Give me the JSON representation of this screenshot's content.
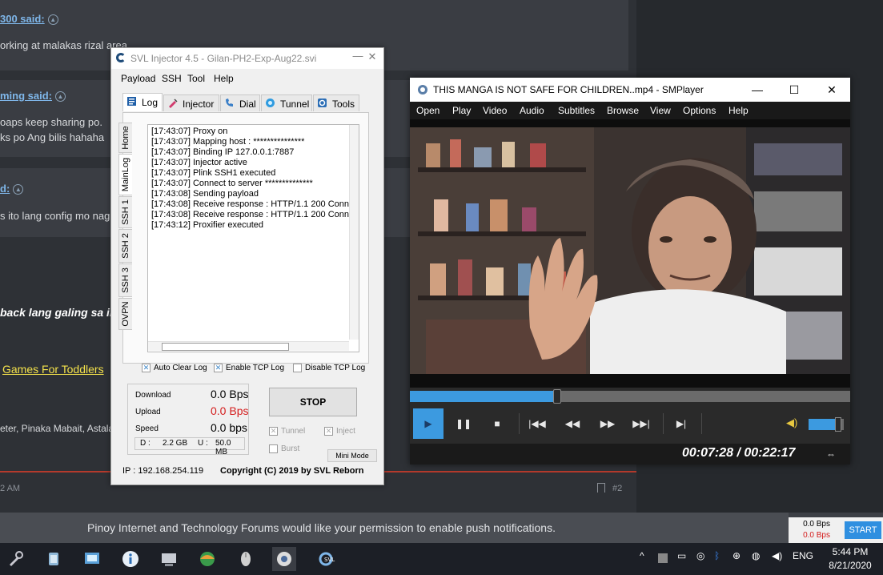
{
  "forum": {
    "post1_user": "300 said:",
    "post1_text": "orking at malakas rizal area",
    "post2_user": "ming said:",
    "post2_line1": "oaps keep sharing po.",
    "post2_line2": "ks po Ang bilis hahaha",
    "post3_user": "d:",
    "post3_text": "s ito lang config mo nagk",
    "bold_text": "back lang galing sa in",
    "link_text": "Games For Toddlers",
    "signature": "eter, Pinaka Mabait, Astala",
    "post_time": "2 AM",
    "post_number": "#2",
    "notification": "Pinoy Internet and Technology Forums would like your permission to enable push notifications."
  },
  "mini_widget": {
    "value1": "0.0 Bps",
    "value2": "0.0 Bps",
    "start_label": "START"
  },
  "svl": {
    "title": "SVL Injector 4.5 - Gilan-PH2-Exp-Aug22.svi",
    "menu": [
      "Payload",
      "SSH",
      "Tool",
      "Help"
    ],
    "tabs": [
      "Log",
      "Injector",
      "Dial",
      "Tunnel",
      "Tools"
    ],
    "side_tabs": [
      "Home",
      "MainLog",
      "SSH 1",
      "SSH 2",
      "SSH 3",
      "OVPN"
    ],
    "log": [
      "[17:43:07] Proxy on",
      "[17:43:07] Mapping host : ***************",
      "[17:43:07] Binding IP 127.0.0.1:7887",
      "[17:43:07] Injector active",
      "[17:43:07] Plink SSH1 executed",
      "[17:43:07] Connect to server **************",
      "[17:43:08] Sending payload",
      "[17:43:08] Receive response : HTTP/1.1 200 Conn",
      "[17:43:08] Receive response : HTTP/1.1 200 Conn",
      "[17:43:12] Proxifier executed"
    ],
    "options": {
      "auto_clear": "Auto Clear Log",
      "enable_tcp": "Enable TCP Log",
      "disable_tcp": "Disable TCP Log"
    },
    "stats": {
      "download_label": "Download",
      "download_value": "0.0 Bps",
      "upload_label": "Upload",
      "upload_value": "0.0 Bps",
      "speed_label": "Speed",
      "speed_value": "0.0 bps",
      "d_label": "D :",
      "d_value": "2.2 GB",
      "u_label": "U :",
      "u_value": "50.0 MB"
    },
    "stop_label": "STOP",
    "tunnel_label": "Tunnel",
    "inject_label": "Inject",
    "burst_label": "Burst",
    "mini_mode_label": "Mini Mode",
    "ip": "IP : 192.168.254.119",
    "copyright": "Copyright (C) 2019 by SVL Reborn",
    "colors": {
      "download": "#000000",
      "upload": "#d41c1c"
    }
  },
  "smplayer": {
    "title": "THIS MANGA IS NOT SAFE FOR CHILDREN..mp4 - SMPlayer",
    "menu": [
      "Open",
      "Play",
      "Video",
      "Audio",
      "Subtitles",
      "Browse",
      "View",
      "Options",
      "Help"
    ],
    "time": "00:07:28 / 00:22:17",
    "seek_fraction": 0.335,
    "volume_fraction": 0.8,
    "accent": "#3c9ae0"
  },
  "taskbar": {
    "lang": "ENG",
    "time": "5:44 PM",
    "date": "8/21/2020"
  }
}
